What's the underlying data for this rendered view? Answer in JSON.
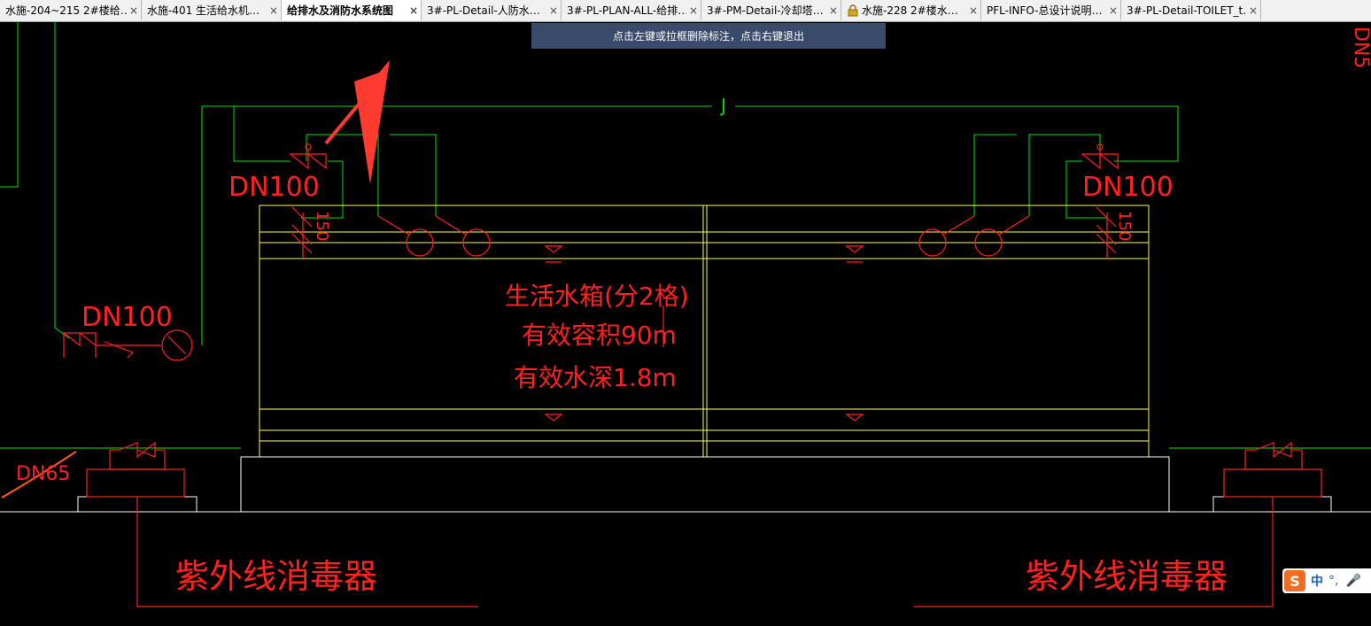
{
  "tabs": [
    {
      "label": "水施-204~215 2#楼给…",
      "active": false
    },
    {
      "label": "水施-401 生活给水机…",
      "active": false
    },
    {
      "label": "给排水及消防水系统图",
      "active": true
    },
    {
      "label": "3#-PL-Detail-人防水…",
      "active": false
    },
    {
      "label": "3#-PL-PLAN-ALL-给排…",
      "active": false
    },
    {
      "label": "3#-PM-Detail-冷却塔…",
      "active": false
    },
    {
      "label": "水施-228 2#楼水…",
      "active": false,
      "locked": true
    },
    {
      "label": "PFL-INFO-总设计说明…",
      "active": false
    },
    {
      "label": "3#-PL-Detail-TOILET_t…",
      "active": false
    }
  ],
  "close_glyph": "×",
  "hint": "点击左键或拉框删除标注，点击右键退出",
  "drawing": {
    "pipe_j": "J",
    "dn100_left_top": "DN100",
    "dn100_right_top": "DN100",
    "dn100_left_mid": "DN100",
    "dim_150_left": "150",
    "dim_150_right": "150",
    "dn65": "DN65",
    "dn_top_right": "DN5",
    "tank_line1": "生活水箱(分2格)",
    "tank_line2": "有效容积90m",
    "tank_line3": "有效水深1.8m",
    "uv_left": "紫外线消毒器",
    "uv_right": "紫外线消毒器"
  },
  "ime": {
    "logo": "S",
    "lang": "中",
    "punct": "°,",
    "mic": "🎤"
  },
  "colors": {
    "green": "#00e000",
    "yellow": "#ffff44",
    "red": "#ff2020",
    "orange": "#ff5a1a",
    "hint_bg": "#3a4a6a"
  }
}
